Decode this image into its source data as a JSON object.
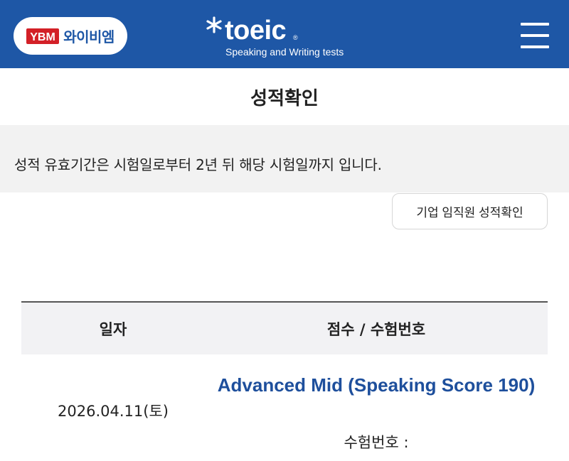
{
  "header": {
    "ybm_logo_text": "와이비엠",
    "ybm_mark_text": "YBM",
    "toeic_word": "toeic",
    "toeic_reg": "®",
    "toeic_subtitle": "Speaking and Writing tests",
    "brand_color": "#1e57a6"
  },
  "page": {
    "title": "성적확인"
  },
  "notice": {
    "text": "성적 유효기간은 시험일로부터 2년 뒤 해당 시험일까지 입니다."
  },
  "actions": {
    "corporate_button": "기업 임직원 성적확인"
  },
  "table": {
    "headers": [
      "일자",
      "점수 / 수험번호"
    ],
    "rows": [
      {
        "date": "2026.04.11(토)",
        "score": "Advanced Mid (Speaking Score 190)",
        "exam_no_label": "수험번호 :"
      }
    ],
    "link_color": "#1e4f9c"
  }
}
